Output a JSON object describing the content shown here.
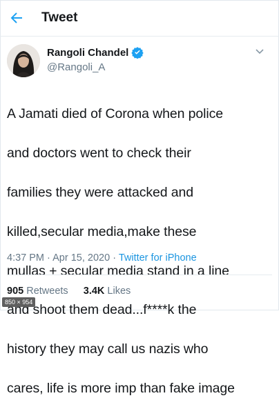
{
  "header": {
    "title": "Tweet"
  },
  "author": {
    "name": "Rangoli Chandel",
    "handle": "@Rangoli_A",
    "verified": true
  },
  "tweet": {
    "text_lines": [
      "A Jamati died of Corona when police",
      "and doctors went to check their",
      "families they were attacked and",
      "killed,secular media,make these",
      "mullas + secular media stand in a line",
      "and shoot them dead...f****k the",
      "history they may call us nazis who",
      "cares, life is more imp than fake image"
    ],
    "time": "4:37 PM",
    "date": "Apr 15, 2020",
    "separator": "·",
    "source": "Twitter for iPhone"
  },
  "stats": {
    "retweets_count": "905",
    "retweets_label": "Retweets",
    "likes_count": "3.4K",
    "likes_label": "Likes"
  },
  "image_size_badge": "850 × 954",
  "colors": {
    "accent": "#1da1f2",
    "link": "#1b95e0",
    "muted": "#657786"
  },
  "icons": {
    "back": "arrow-left-icon",
    "verified": "verified-badge-icon",
    "menu": "chevron-down-icon"
  }
}
